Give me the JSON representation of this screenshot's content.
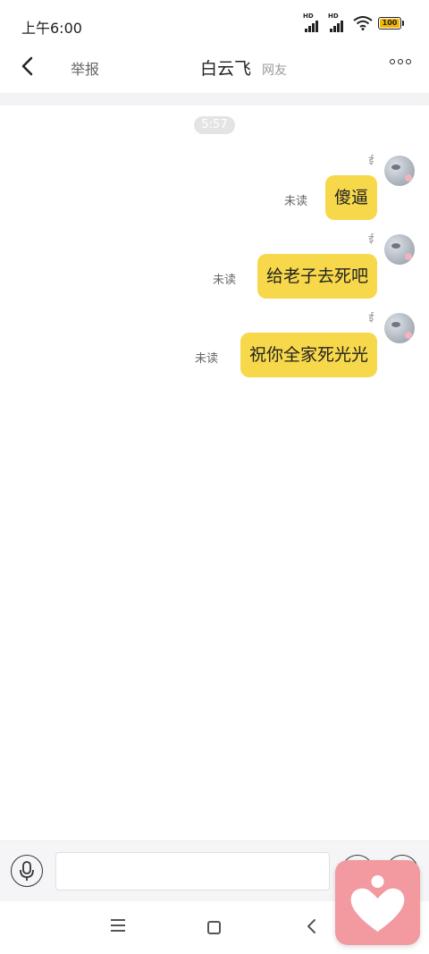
{
  "status_bar": {
    "time": "上午6:00",
    "signal1_label": "HD",
    "signal2_label": "HD",
    "battery": "100"
  },
  "header": {
    "report_label": "举报",
    "title": "白云飞",
    "subtitle": "网友"
  },
  "chat": {
    "timestamp": "5:57",
    "messages": [
      {
        "sender_mark": "ई",
        "text": "傻逼",
        "status": "未读"
      },
      {
        "sender_mark": "ई",
        "text": "给老子去死吧",
        "status": "未读"
      },
      {
        "sender_mark": "ई",
        "text": "祝你全家死光光",
        "status": "未读"
      }
    ]
  },
  "input": {
    "placeholder": "",
    "value": ""
  },
  "colors": {
    "bubble": "#f7d84a",
    "widget": "#f29aa0"
  }
}
